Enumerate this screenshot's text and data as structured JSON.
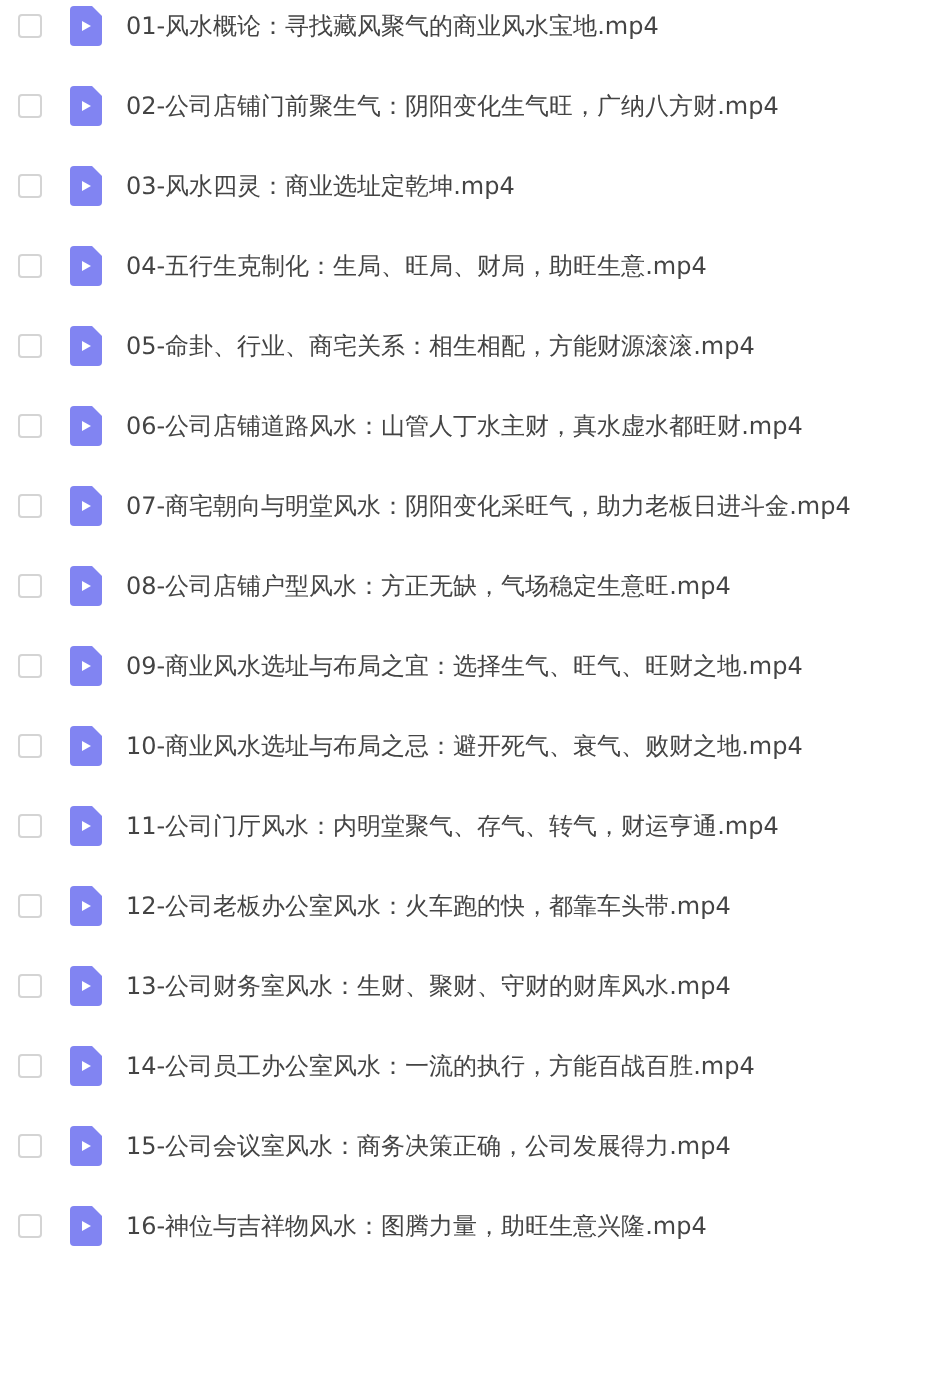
{
  "files": [
    {
      "name": "01-风水概论：寻找藏风聚气的商业风水宝地.mp4",
      "checked": false
    },
    {
      "name": "02-公司店铺门前聚生气：阴阳变化生气旺，广纳八方财.mp4",
      "checked": false
    },
    {
      "name": "03-风水四灵：商业选址定乾坤.mp4",
      "checked": false
    },
    {
      "name": "04-五行生克制化：生局、旺局、财局，助旺生意.mp4",
      "checked": false
    },
    {
      "name": "05-命卦、行业、商宅关系：相生相配，方能财源滚滚.mp4",
      "checked": false
    },
    {
      "name": "06-公司店铺道路风水：山管人丁水主财，真水虚水都旺财.mp4",
      "checked": false
    },
    {
      "name": "07-商宅朝向与明堂风水：阴阳变化采旺气，助力老板日进斗金.mp4",
      "checked": false
    },
    {
      "name": "08-公司店铺户型风水：方正无缺，气场稳定生意旺.mp4",
      "checked": false
    },
    {
      "name": "09-商业风水选址与布局之宜：选择生气、旺气、旺财之地.mp4",
      "checked": false
    },
    {
      "name": "10-商业风水选址与布局之忌：避开死气、衰气、败财之地.mp4",
      "checked": false
    },
    {
      "name": "11-公司门厅风水：内明堂聚气、存气、转气，财运亨通.mp4",
      "checked": false
    },
    {
      "name": "12-公司老板办公室风水：火车跑的快，都靠车头带.mp4",
      "checked": false
    },
    {
      "name": "13-公司财务室风水：生财、聚财、守财的财库风水.mp4",
      "checked": false
    },
    {
      "name": "14-公司员工办公室风水：一流的执行，方能百战百胜.mp4",
      "checked": false
    },
    {
      "name": "15-公司会议室风水：商务决策正确，公司发展得力.mp4",
      "checked": false
    },
    {
      "name": "16-神位与吉祥物风水：图腾力量，助旺生意兴隆.mp4",
      "checked": false
    }
  ]
}
